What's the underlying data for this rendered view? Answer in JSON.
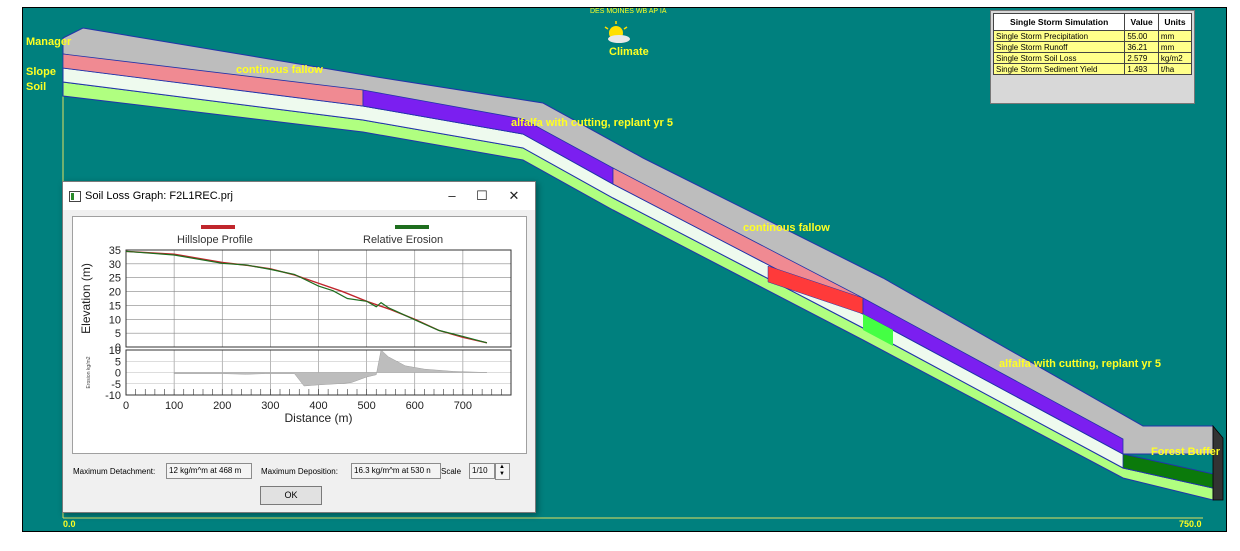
{
  "scene": {
    "station_label": "DES MOINES WB AP IA",
    "climate_label": "Climate",
    "layer_labels": {
      "management": "Manager",
      "slope": "Slope",
      "soil": "Soil"
    },
    "ofe_labels": [
      "continous fallow",
      "alfalfa with cutting, replant yr 5",
      "continous fallow",
      "alfalfa with cutting, replant yr 5",
      "Forest Buffer"
    ],
    "axis_start": "0.0",
    "axis_end": "750.0",
    "colors": {
      "background": "#00807e",
      "top_surface": "#bdbdbd",
      "fallow": "#f08a92",
      "alfalfa": "#7b1ff0",
      "forest": "#0b7a0b",
      "soil_light": "#e8f8e8",
      "soil_green": "#b0ff80"
    }
  },
  "results": {
    "headers": [
      "Single Storm Simulation",
      "Value",
      "Units"
    ],
    "rows": [
      {
        "label": "Single Storm Precipitation",
        "value": "55.00",
        "unit": "mm"
      },
      {
        "label": "Single Storm Runoff",
        "value": "36.21",
        "unit": "mm"
      },
      {
        "label": "Single Storm Soil Loss",
        "value": "2.579",
        "unit": "kg/m2"
      },
      {
        "label": "Single Storm Sediment Yield",
        "value": "1.493",
        "unit": "t/ha"
      }
    ]
  },
  "dialog": {
    "title": "Soil Loss Graph: F2L1REC.prj",
    "minimize": "–",
    "maximize": "☐",
    "close": "✕",
    "max_detachment_label": "Maximum Detachment:",
    "max_detachment_value": "12 kg/m^m at 468 m",
    "max_deposition_label": "Maximum Deposition:",
    "max_deposition_value": "16.3 kg/m^m at 530 n",
    "scale_label": "Scale",
    "scale_value": "1/10",
    "ok_label": "OK"
  },
  "chart_data": {
    "type": "line",
    "legend": [
      "Hillslope Profile",
      "Relative Erosion"
    ],
    "legend_colors": [
      "#c0262c",
      "#1e6e1e"
    ],
    "xlabel": "Distance (m)",
    "ylabel": "Elevation (m)",
    "ylabel2": "Erosion kg/m2",
    "xlim": [
      0,
      800
    ],
    "ylim": [
      0,
      35
    ],
    "ylim2": [
      -10,
      10
    ],
    "xticks": [
      0,
      100,
      200,
      300,
      400,
      500,
      600,
      700
    ],
    "yticks": [
      0,
      5,
      10,
      15,
      20,
      25,
      30,
      35
    ],
    "yticks2": [
      -10,
      -5,
      0,
      5,
      10
    ],
    "profile": {
      "x": [
        0,
        100,
        200,
        250,
        300,
        350,
        400,
        450,
        500,
        550,
        600,
        650,
        700,
        750
      ],
      "y": [
        34.5,
        33.5,
        30.5,
        29.5,
        28.2,
        26.0,
        23.0,
        20.0,
        16.5,
        13.5,
        10.0,
        6.0,
        3.5,
        1.5
      ]
    },
    "erosion_line": {
      "x": [
        0,
        100,
        200,
        250,
        300,
        350,
        400,
        430,
        460,
        500,
        520,
        530,
        545,
        560,
        600,
        650,
        700,
        750
      ],
      "y": [
        34.5,
        33.2,
        30.2,
        29.6,
        28.0,
        26.2,
        22.0,
        20.3,
        17.5,
        16.5,
        14.5,
        16.0,
        14.2,
        13.0,
        9.8,
        6.0,
        3.8,
        1.5
      ]
    },
    "erosion_bars": {
      "x": [
        100,
        200,
        250,
        290,
        350,
        370,
        400,
        440,
        468,
        500,
        520,
        530,
        545,
        580,
        620,
        680,
        750
      ],
      "y": [
        -0.5,
        -0.5,
        -0.8,
        -0.5,
        -0.5,
        -6,
        -5.5,
        -5,
        -4.5,
        -2,
        -1,
        10,
        7,
        3,
        1.5,
        0.5,
        0
      ]
    }
  }
}
